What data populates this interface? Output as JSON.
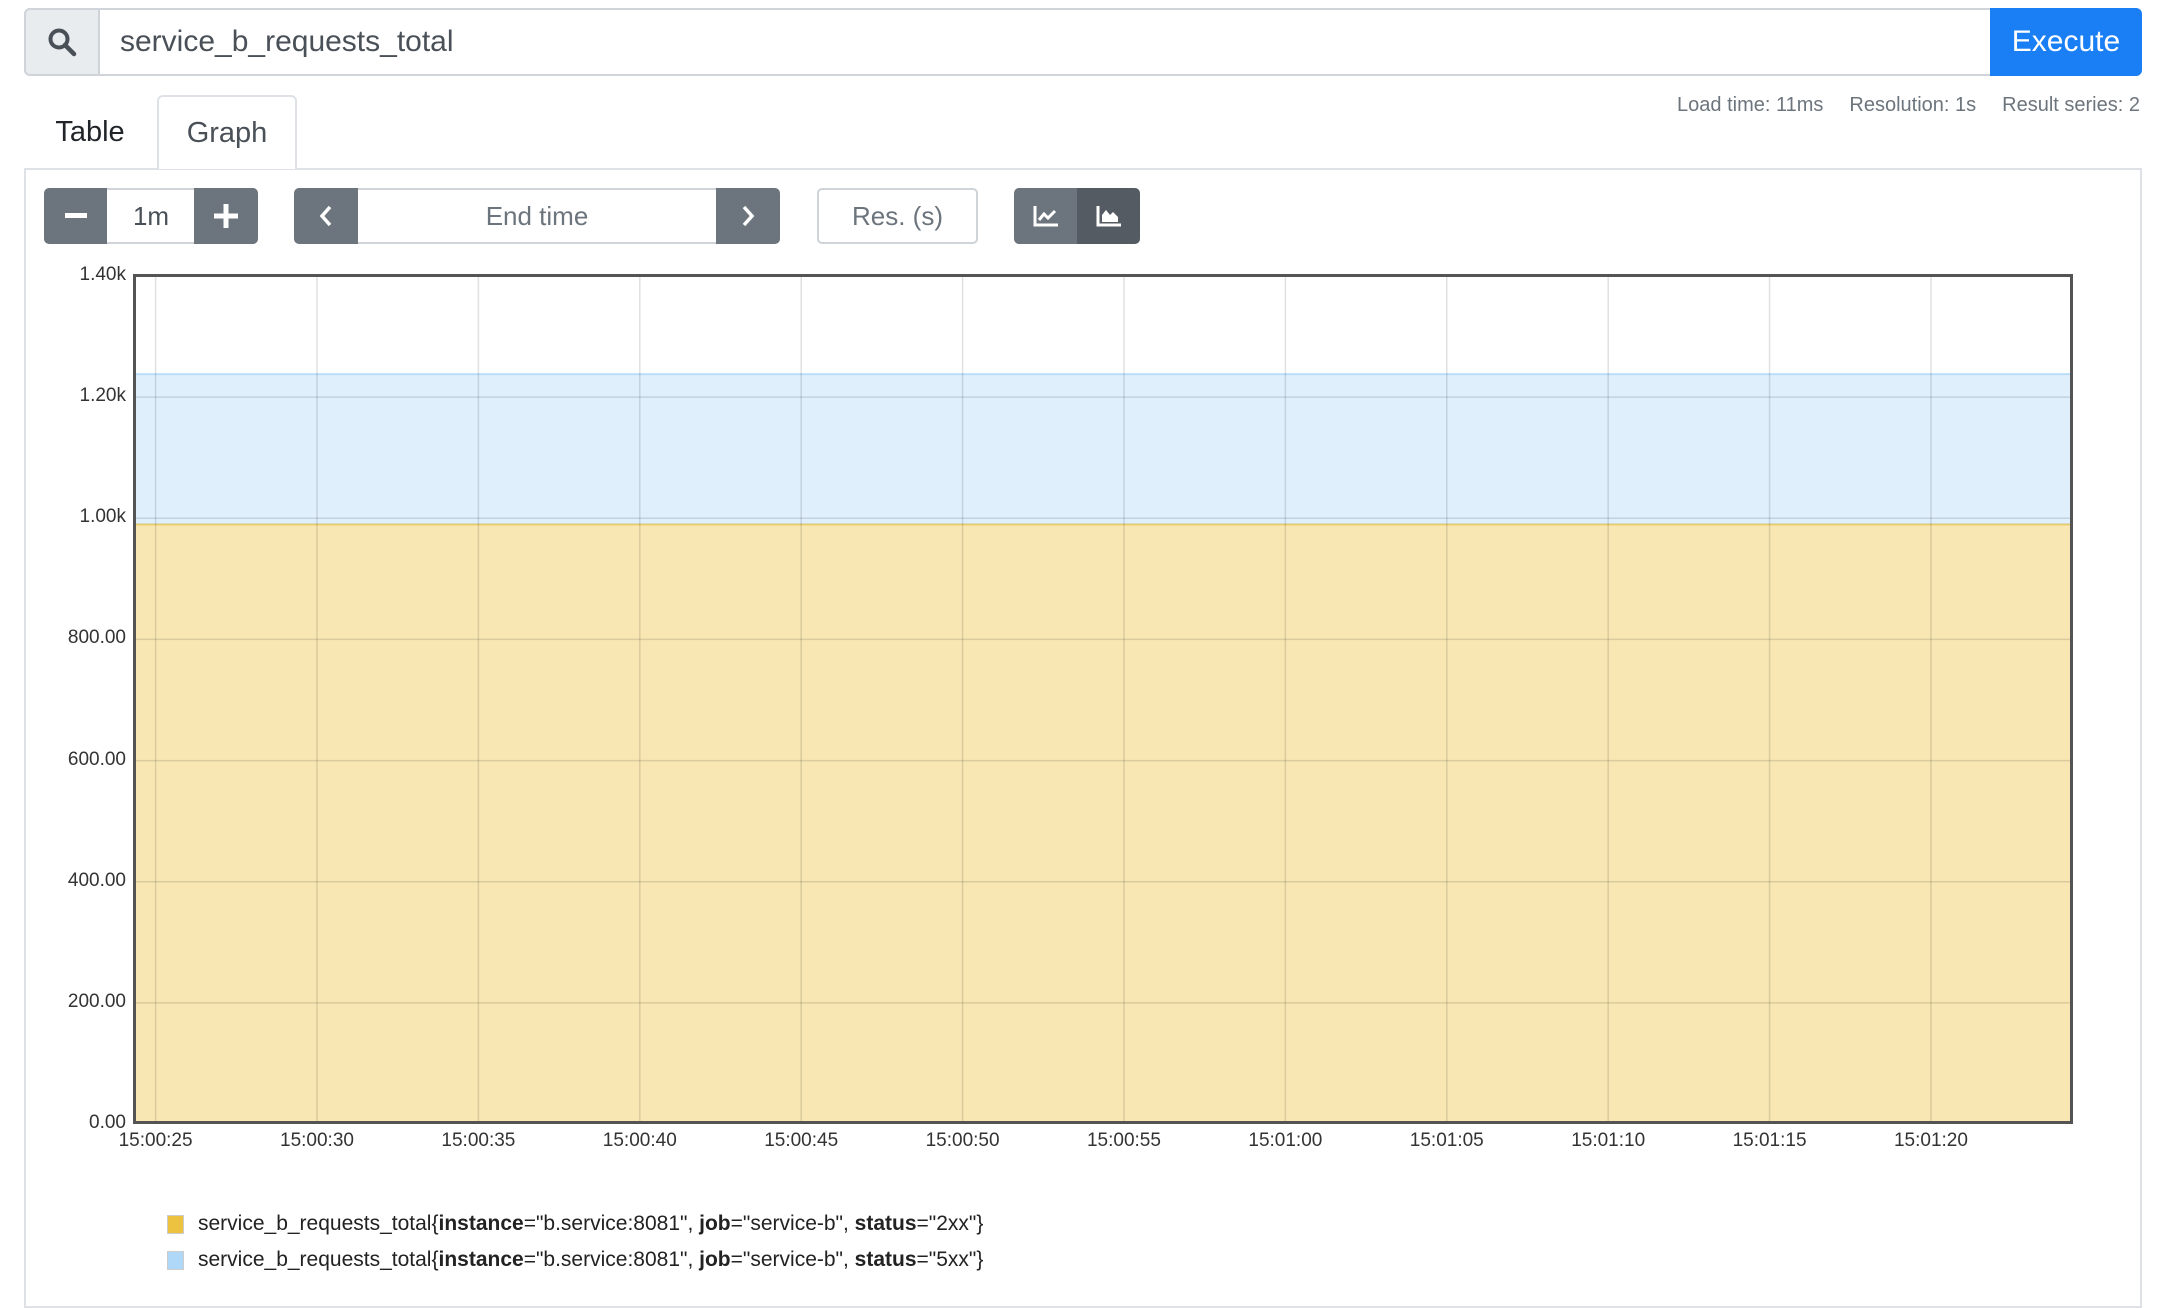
{
  "search": {
    "query": "service_b_requests_total",
    "execute_label": "Execute",
    "icon": "search-icon"
  },
  "tabs": [
    {
      "label": "Table",
      "active": false
    },
    {
      "label": "Graph",
      "active": true
    }
  ],
  "stats": {
    "load_time": "Load time: 11ms",
    "resolution": "Resolution: 1s",
    "result_series": "Result series: 2"
  },
  "controls": {
    "range": "1m",
    "end_time_placeholder": "End time",
    "resolution_placeholder": "Res. (s)",
    "chart_mode": "stacked"
  },
  "colors": {
    "accent": "#1a7ff5",
    "series_2xx": "#edc240",
    "series_5xx": "#afd8f8"
  },
  "chart_data": {
    "type": "area",
    "stacked": true,
    "x_range": [
      "15:00:24.3",
      "15:01:24.4"
    ],
    "x_ticks": [
      "15:00:25",
      "15:00:30",
      "15:00:35",
      "15:00:40",
      "15:00:45",
      "15:00:50",
      "15:00:55",
      "15:01:00",
      "15:01:05",
      "15:01:10",
      "15:01:15",
      "15:01:20"
    ],
    "y_ticks": [
      "0.00",
      "200.00",
      "400.00",
      "600.00",
      "800.00",
      "1.00k",
      "1.20k",
      "1.40k"
    ],
    "ylim": [
      0,
      1400
    ],
    "grid": true,
    "legend_position": "bottom",
    "series": [
      {
        "name_metric": "service_b_requests_total",
        "labels": [
          [
            "instance",
            "\"b.service:8081\""
          ],
          [
            "job",
            "\"service-b\""
          ],
          [
            "status",
            "\"2xx\""
          ]
        ],
        "color": "#edc240",
        "value": 990
      },
      {
        "name_metric": "service_b_requests_total",
        "labels": [
          [
            "instance",
            "\"b.service:8081\""
          ],
          [
            "job",
            "\"service-b\""
          ],
          [
            "status",
            "\"5xx\""
          ]
        ],
        "color": "#afd8f8",
        "value": 248
      }
    ]
  }
}
